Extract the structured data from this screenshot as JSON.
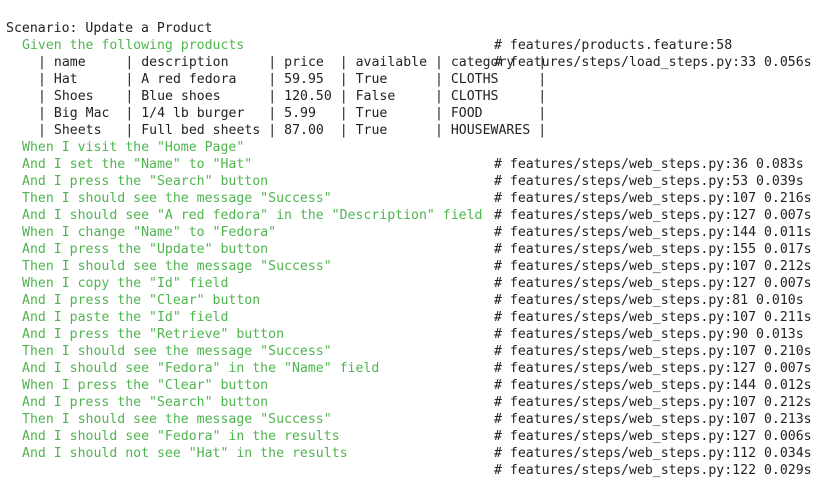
{
  "scenario": {
    "header": "Scenario: Update a Product",
    "location": "# features/products.feature:58"
  },
  "given": {
    "text": "Given the following products",
    "location": "# features/steps/load_steps.py:33 0.056s"
  },
  "table": {
    "rows": [
      "| name     | description     | price  | available | category   |",
      "| Hat      | A red fedora    | 59.95  | True      | CLOTHS     |",
      "| Shoes    | Blue shoes      | 120.50 | False     | CLOTHS     |",
      "| Big Mac  | 1/4 lb burger   | 5.99   | True      | FOOD       |",
      "| Sheets   | Full bed sheets | 87.00  | True      | HOUSEWARES |"
    ]
  },
  "steps": [
    {
      "text": "When I visit the \"Home Page\"",
      "location": "# features/steps/web_steps.py:36 0.083s"
    },
    {
      "text": "And I set the \"Name\" to \"Hat\"",
      "location": "# features/steps/web_steps.py:53 0.039s"
    },
    {
      "text": "And I press the \"Search\" button",
      "location": "# features/steps/web_steps.py:107 0.216s"
    },
    {
      "text": "Then I should see the message \"Success\"",
      "location": "# features/steps/web_steps.py:127 0.007s"
    },
    {
      "text": "And I should see \"A red fedora\" in the \"Description\" field",
      "location": "# features/steps/web_steps.py:144 0.011s"
    },
    {
      "text": "When I change \"Name\" to \"Fedora\"",
      "location": "# features/steps/web_steps.py:155 0.017s"
    },
    {
      "text": "And I press the \"Update\" button",
      "location": "# features/steps/web_steps.py:107 0.212s"
    },
    {
      "text": "Then I should see the message \"Success\"",
      "location": "# features/steps/web_steps.py:127 0.007s"
    },
    {
      "text": "When I copy the \"Id\" field",
      "location": "# features/steps/web_steps.py:81 0.010s"
    },
    {
      "text": "And I press the \"Clear\" button",
      "location": "# features/steps/web_steps.py:107 0.211s"
    },
    {
      "text": "And I paste the \"Id\" field",
      "location": "# features/steps/web_steps.py:90 0.013s"
    },
    {
      "text": "And I press the \"Retrieve\" button",
      "location": "# features/steps/web_steps.py:107 0.210s"
    },
    {
      "text": "Then I should see the message \"Success\"",
      "location": "# features/steps/web_steps.py:127 0.007s"
    },
    {
      "text": "And I should see \"Fedora\" in the \"Name\" field",
      "location": "# features/steps/web_steps.py:144 0.012s"
    },
    {
      "text": "When I press the \"Clear\" button",
      "location": "# features/steps/web_steps.py:107 0.212s"
    },
    {
      "text": "And I press the \"Search\" button",
      "location": "# features/steps/web_steps.py:107 0.213s"
    },
    {
      "text": "Then I should see the message \"Success\"",
      "location": "# features/steps/web_steps.py:127 0.006s"
    },
    {
      "text": "And I should see \"Fedora\" in the results",
      "location": "# features/steps/web_steps.py:112 0.034s"
    },
    {
      "text": "And I should not see \"Hat\" in the results",
      "location": "# features/steps/web_steps.py:122 0.029s"
    }
  ],
  "colors": {
    "step_green": "#4fb54f",
    "text": "#222222",
    "background": "#ffffff"
  }
}
